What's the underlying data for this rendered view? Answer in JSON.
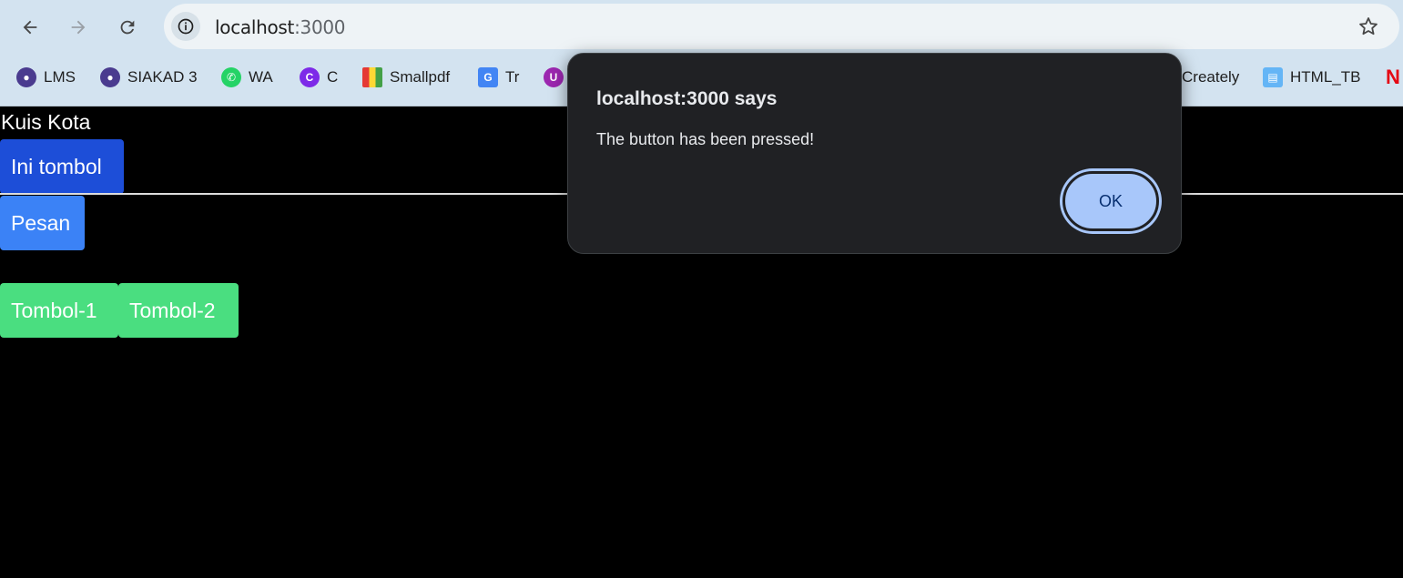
{
  "browser": {
    "url_host": "localhost",
    "url_port": ":3000",
    "bookmarks": [
      {
        "label": "LMS",
        "icon": "university-seal-icon"
      },
      {
        "label": "SIAKAD 3",
        "icon": "university-seal-icon"
      },
      {
        "label": "WA",
        "icon": "whatsapp-icon"
      },
      {
        "label": "C",
        "icon": "canva-icon"
      },
      {
        "label": "Smallpdf",
        "icon": "smallpdf-icon"
      },
      {
        "label": "Tr",
        "icon": "google-translate-icon"
      },
      {
        "label": "",
        "icon": "purple-circle-icon"
      },
      {
        "label": "Creately",
        "icon": "creately-icon"
      },
      {
        "label": "HTML_TB",
        "icon": "book-icon"
      },
      {
        "label": "",
        "icon": "netflix-icon"
      }
    ]
  },
  "page": {
    "title": "Kuis Kota",
    "buttons": {
      "ini_tombol": "Ini tombol",
      "pesan": "Pesan",
      "tombol1": "Tombol-1",
      "tombol2": "Tombol-2"
    },
    "colors": {
      "blue_dark": "#1d4ed8",
      "blue": "#3b82f6",
      "green": "#4ade80"
    }
  },
  "dialog": {
    "title": "localhost:3000 says",
    "message": "The button has been pressed!",
    "ok_label": "OK"
  }
}
